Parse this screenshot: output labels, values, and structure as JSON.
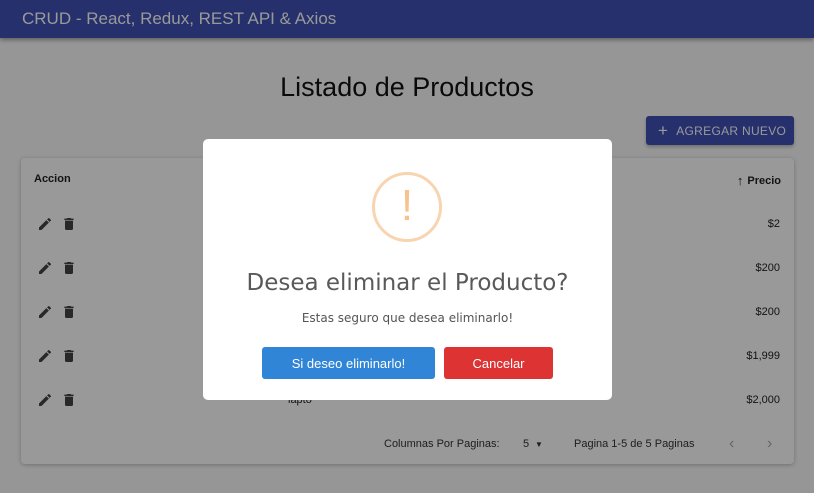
{
  "app": {
    "title": "CRUD - React, Redux, REST API & Axios"
  },
  "page": {
    "title": "Listado de Productos",
    "add_button": "AGREGAR NUEVO"
  },
  "table": {
    "headers": {
      "accion": "Accion",
      "precio": "Precio"
    },
    "rows": [
      {
        "nombre": "",
        "precio": "$2"
      },
      {
        "nombre": "",
        "precio": "$200"
      },
      {
        "nombre": "",
        "precio": "$200"
      },
      {
        "nombre": "",
        "precio": "$1,999"
      },
      {
        "nombre": "lapto",
        "precio": "$2,000"
      }
    ],
    "footer": {
      "rows_per_page_label": "Columnas Por Paginas:",
      "rows_per_page_value": "5",
      "page_info": "Pagina 1-5 de 5 Paginas"
    }
  },
  "modal": {
    "icon": "!",
    "title": "Desea eliminar el Producto?",
    "text": "Estas seguro que desea eliminarlo!",
    "confirm_label": "Si deseo eliminarlo!",
    "cancel_label": "Cancelar"
  },
  "colors": {
    "primary": "#3f51b5",
    "confirm": "#3085d6",
    "cancel": "#dd3333",
    "warning": "#f8bb86"
  }
}
